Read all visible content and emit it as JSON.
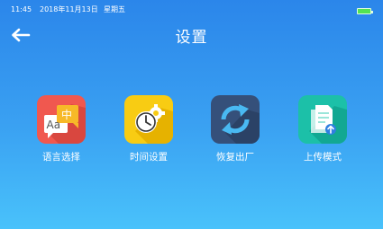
{
  "status_bar": {
    "time": "11:45",
    "date": "2018年11月13日",
    "weekday": "星期五",
    "battery_level": 1.0
  },
  "header": {
    "title": "设置",
    "back_icon": "arrow-left-icon"
  },
  "tiles": [
    {
      "label": "语言选择",
      "icon": "language-icon",
      "color": "#f0584f",
      "glyph_en": "Aa",
      "glyph_cn": "中"
    },
    {
      "label": "时间设置",
      "icon": "clock-gear-icon",
      "color": "#f8cc13"
    },
    {
      "label": "恢复出厂",
      "icon": "refresh-icon",
      "color": "#35507a"
    },
    {
      "label": "上传模式",
      "icon": "upload-document-icon",
      "color": "#1cc0a8"
    }
  ],
  "colors": {
    "background_top": "#2b86ea",
    "background_bottom": "#49c2fb",
    "battery": "#53e351"
  }
}
